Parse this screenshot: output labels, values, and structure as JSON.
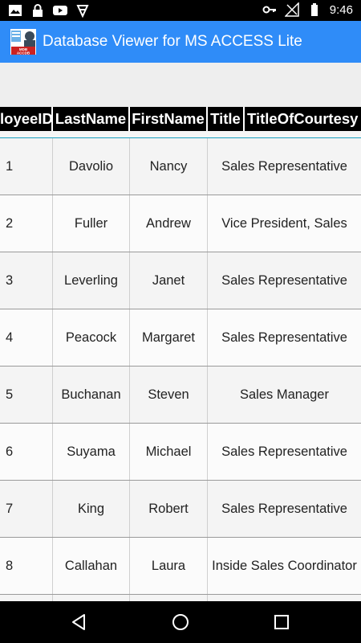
{
  "status_bar": {
    "time": "9:46",
    "left_icons": [
      "image-icon",
      "lock-icon",
      "youtube-icon",
      "play-store-icon"
    ],
    "right_icons": [
      "vpn-key-icon",
      "signal-icon",
      "battery-icon"
    ]
  },
  "app_bar": {
    "title": "Database Viewer for MS ACCESS Lite",
    "logo_text": "MDB ACCDB"
  },
  "table": {
    "columns": [
      "EmployeeID",
      "LastName",
      "FirstName",
      "Title",
      "TitleOfCourtesy"
    ],
    "column_visible": [
      "loyeeID",
      "LastName",
      "FirstName",
      "Title",
      "TitleOfCourtesy"
    ],
    "rows": [
      {
        "id": "1",
        "last": "Davolio",
        "first": "Nancy",
        "title": "Sales Representative"
      },
      {
        "id": "2",
        "last": "Fuller",
        "first": "Andrew",
        "title": "Vice President, Sales"
      },
      {
        "id": "3",
        "last": "Leverling",
        "first": "Janet",
        "title": "Sales Representative"
      },
      {
        "id": "4",
        "last": "Peacock",
        "first": "Margaret",
        "title": "Sales Representative"
      },
      {
        "id": "5",
        "last": "Buchanan",
        "first": "Steven",
        "title": "Sales Manager"
      },
      {
        "id": "6",
        "last": "Suyama",
        "first": "Michael",
        "title": "Sales Representative"
      },
      {
        "id": "7",
        "last": "King",
        "first": "Robert",
        "title": "Sales Representative"
      },
      {
        "id": "8",
        "last": "Callahan",
        "first": "Laura",
        "title": "Inside Sales Coordinator"
      }
    ]
  },
  "nav_bar": {
    "buttons": [
      "back-icon",
      "home-icon",
      "recents-icon"
    ]
  },
  "colors": {
    "app_bar": "#2f8cf8",
    "header_bg": "#000000",
    "accent_line": "#1aa0c0"
  }
}
